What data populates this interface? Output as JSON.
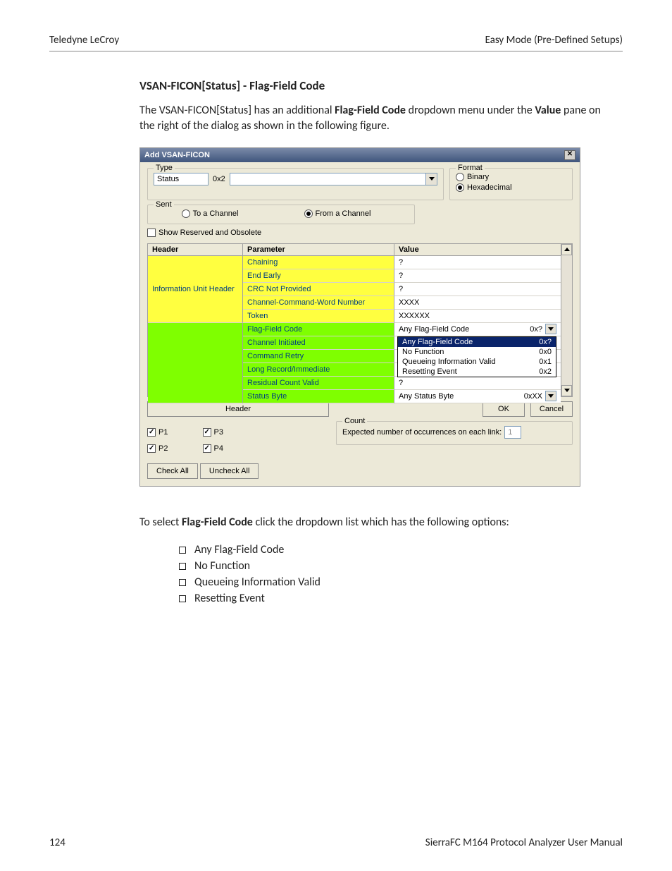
{
  "header_left": "Teledyne LeCroy",
  "header_right": "Easy Mode (Pre-Defined Setups)",
  "section_title": "VSAN-FICON[Status] - Flag-Field Code",
  "para1_a": "The VSAN-FICON[Status] has an additional ",
  "para1_b": "Flag-Field Code",
  "para1_c": " dropdown menu under the ",
  "para1_d": "Value",
  "para1_e": " pane on the right of the dialog as shown in the following figure.",
  "dlg": {
    "title": "Add VSAN-FICON",
    "type_legend": "Type",
    "type_name": "Status",
    "type_code": "0x2",
    "format_legend": "Format",
    "format_binary": "Binary",
    "format_hex": "Hexadecimal",
    "sent_legend": "Sent",
    "sent_to": "To a Channel",
    "sent_from": "From a Channel",
    "show_reserved": "Show Reserved and Obsolete",
    "col_header": "Header",
    "col_param": "Parameter",
    "col_value": "Value",
    "group1": "Information Unit Header",
    "rows_y": [
      {
        "p": "Chaining",
        "v": "?"
      },
      {
        "p": "End Early",
        "v": "?"
      },
      {
        "p": "CRC Not Provided",
        "v": "?"
      },
      {
        "p": "Channel-Command-Word Number",
        "v": "XXXX"
      },
      {
        "p": "Token",
        "v": "XXXXXX"
      }
    ],
    "rows_g": [
      {
        "p": "Flag-Field Code",
        "vL": "Any Flag-Field Code",
        "vR": "0x?",
        "dd": true
      },
      {
        "p": "Channel Initiated"
      },
      {
        "p": "Command Retry"
      },
      {
        "p": "Long Record/Immediate"
      },
      {
        "p": "Residual Count Valid",
        "v": "?"
      },
      {
        "p": "Status Byte",
        "vL": "Any Status Byte",
        "vR": "0xXX",
        "dd": true
      }
    ],
    "dropdown": [
      {
        "l": "Any Flag-Field Code",
        "r": "0x?",
        "sel": true
      },
      {
        "l": "No Function",
        "r": "0x0"
      },
      {
        "l": "Queueing Information Valid",
        "r": "0x1"
      },
      {
        "l": "Resetting Event",
        "r": "0x2"
      }
    ],
    "header_btn": "Header",
    "ok": "OK",
    "cancel": "Cancel",
    "count_legend": "Count",
    "count_label": "Expected number of occurrences on each link:",
    "count_val": "1",
    "p1": "P1",
    "p2": "P2",
    "p3": "P3",
    "p4": "P4",
    "check_all": "Check All",
    "uncheck_all": "Uncheck All"
  },
  "para2_a": "To select ",
  "para2_b": "Flag-Field Code",
  "para2_c": " click the dropdown list which has the following options:",
  "opts": [
    "Any Flag-Field Code",
    "No Function",
    "Queueing Information Valid",
    "Resetting Event"
  ],
  "footer_left": "124",
  "footer_right": "SierraFC M164 Protocol Analyzer User Manual"
}
